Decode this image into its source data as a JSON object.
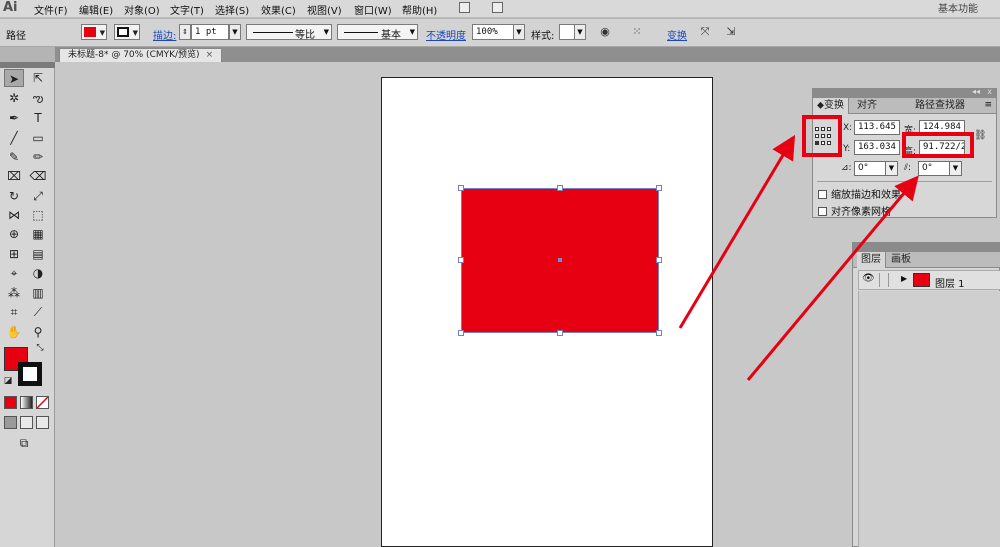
{
  "menubar": {
    "logo": "Ai",
    "items": [
      "文件(F)",
      "编辑(E)",
      "对象(O)",
      "文字(T)",
      "选择(S)",
      "效果(C)",
      "视图(V)",
      "窗口(W)",
      "帮助(H)"
    ],
    "workspace": "基本功能"
  },
  "control": {
    "selection_type": "路径",
    "fill_color": "#e60012",
    "stroke_label": "描边:",
    "stroke_weight": "1 pt",
    "profile": "等比",
    "brush": "基本",
    "opacity_label": "不透明度",
    "opacity": "100%",
    "style_label": "样式:",
    "transform_link": "变换"
  },
  "document": {
    "tab_title": "未标题-8* @ 70% (CMYK/预览)",
    "tab_close": "×"
  },
  "artwork": {
    "rect_fill": "#e60012"
  },
  "transform_panel": {
    "tabs": [
      "变换",
      "对齐",
      "路径查找器"
    ],
    "menu": "≡",
    "collapse": "◂◂",
    "close": "x",
    "x_label": "X:",
    "x_value": "113.645",
    "y_label": "Y:",
    "y_value": "163.034",
    "w_label": "宽:",
    "w_value": "124.984",
    "h_label": "高:",
    "h_value": "91.722/2",
    "rotate_value": "0°",
    "shear_value": "0°",
    "scale_strokes": "缩放描边和效果",
    "align_pixel": "对齐像素网格"
  },
  "layers_panel": {
    "tabs": [
      "图层",
      "画板"
    ],
    "layer_name": "图层 1"
  },
  "annotation_color": "#e60012"
}
